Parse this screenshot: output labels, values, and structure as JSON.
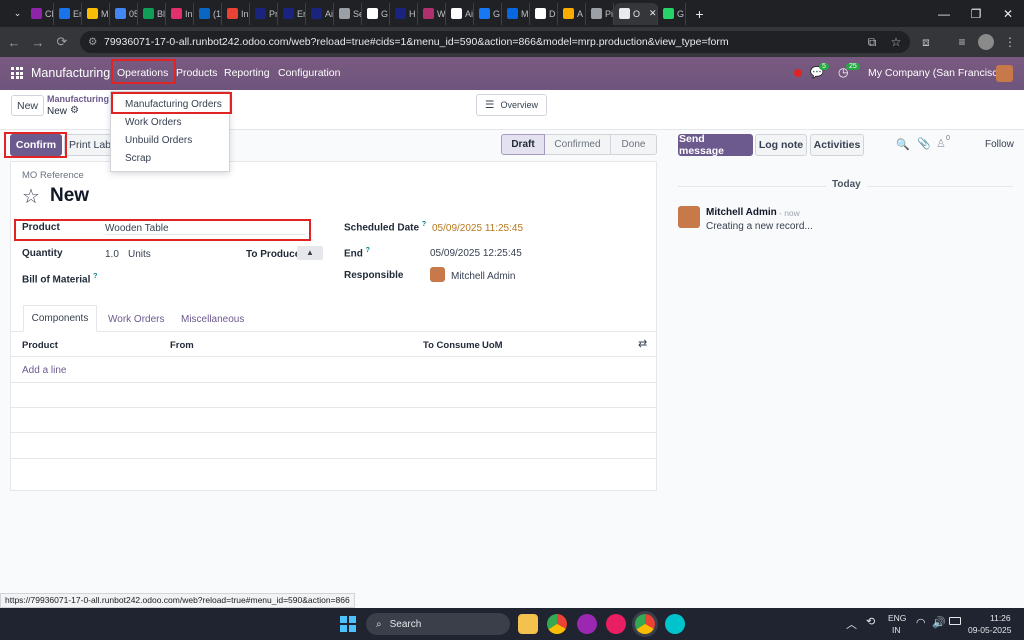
{
  "browser": {
    "tabs": [
      {
        "label": "Cl",
        "color": "#8e24aa"
      },
      {
        "label": "Er",
        "color": "#1a73e8"
      },
      {
        "label": "M",
        "color": "#fbbc04"
      },
      {
        "label": "05",
        "color": "#4285f4"
      },
      {
        "label": "Bl",
        "color": "#0f9d58"
      },
      {
        "label": "In",
        "color": "#e1306c"
      },
      {
        "label": "(1",
        "color": "#0a66c2"
      },
      {
        "label": "In",
        "color": "#ea4335"
      },
      {
        "label": "Pr",
        "color": "#1a237e"
      },
      {
        "label": "Er",
        "color": "#1a237e"
      },
      {
        "label": "Ai",
        "color": "#1a237e"
      },
      {
        "label": "Se",
        "color": "#9aa0a6"
      },
      {
        "label": "G",
        "color": "#ffffff"
      },
      {
        "label": "H",
        "color": "#1a237e"
      },
      {
        "label": "W",
        "color": "#b0306e"
      },
      {
        "label": "Ai",
        "color": "#ffffff"
      },
      {
        "label": "G",
        "color": "#1877f2"
      },
      {
        "label": "M",
        "color": "#0668e1"
      },
      {
        "label": "D",
        "color": "#ffffff"
      },
      {
        "label": "A",
        "color": "#f9ab00"
      },
      {
        "label": "Pi",
        "color": "#9aa0a6"
      },
      {
        "label": "O",
        "color": "#e8eaed"
      },
      {
        "label": "G",
        "color": "#25d366"
      }
    ],
    "url": "79936071-17-0-all.runbot242.odoo.com/web?reload=true#cids=1&menu_id=590&action=866&model=mrp.production&view_type=form",
    "status_url": "https://79936071-17-0-all.runbot242.odoo.com/web?reload=true#menu_id=590&action=866"
  },
  "topbar": {
    "app_name": "Manufacturing",
    "menu": [
      "Operations",
      "Products",
      "Reporting",
      "Configuration"
    ],
    "messages_badge": "5",
    "activity_badge": "25",
    "company": "My Company (San Francisco)"
  },
  "dropdown": {
    "items": [
      "Manufacturing Orders",
      "Work Orders",
      "Unbuild Orders",
      "Scrap"
    ]
  },
  "control": {
    "new_button": "New",
    "breadcrumb_parent": "Manufacturing Orders",
    "breadcrumb_current": "New",
    "overview_button": "Overview",
    "confirm_button": "Confirm",
    "print_button": "Print Labels",
    "status_steps": [
      "Draft",
      "Confirmed",
      "Done"
    ],
    "status_active": "Draft"
  },
  "form": {
    "mo_reference_label": "MO Reference",
    "title": "New",
    "product_label": "Product",
    "product_value": "Wooden Table",
    "quantity_label": "Quantity",
    "quantity_value": "1.0",
    "quantity_uom": "Units",
    "to_produce_label": "To Produce",
    "bom_label": "Bill of Material",
    "scheduled_label": "Scheduled Date",
    "scheduled_value": "05/09/2025 11:25:45",
    "end_label": "End",
    "end_value": "05/09/2025 12:25:45",
    "responsible_label": "Responsible",
    "responsible_value": "Mitchell Admin",
    "help_mark": "?",
    "tabs": [
      "Components",
      "Work Orders",
      "Miscellaneous"
    ],
    "columns": [
      "Product",
      "From",
      "To Consume",
      "UoM"
    ],
    "add_line": "Add a line"
  },
  "chatter": {
    "send_message": "Send message",
    "log_note": "Log note",
    "activities": "Activities",
    "attachments_count": "0",
    "follow": "Follow",
    "date_separator": "Today",
    "author": "Mitchell Admin",
    "time": "- now",
    "message": "Creating a new record..."
  },
  "taskbar": {
    "search": "Search",
    "lang_top": "ENG",
    "lang_bottom": "IN",
    "time": "11:26",
    "date": "09-05-2025"
  },
  "colors": {
    "topbar": "#6e557d",
    "primary": "#6c5a8e",
    "highlight_box": "#e02424",
    "teal": "#017e84"
  }
}
